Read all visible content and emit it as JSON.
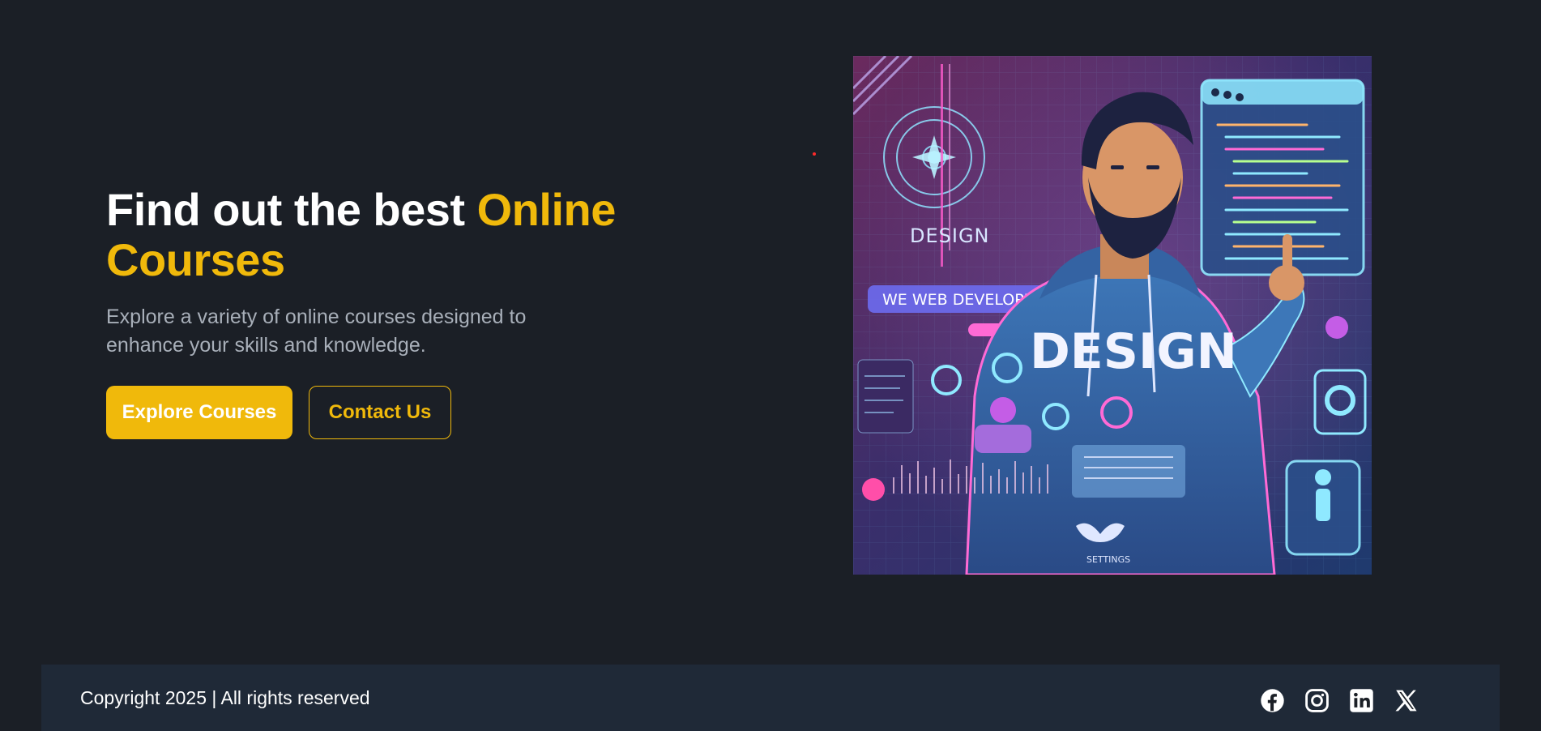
{
  "hero": {
    "headline_prefix": "Find out the best ",
    "headline_accent": "Online Courses",
    "subtitle": "Explore a variety of online courses designed to enhance your skills and knowledge.",
    "primary_button": "Explore Courses",
    "secondary_button": "Contact Us",
    "image": {
      "alt": "Web developer illustration",
      "labels": {
        "design_small": "DESIGN",
        "banner": "WE WEB DEVELOPER",
        "shirt": "DESIGN",
        "settings": "SETTINGS"
      }
    }
  },
  "footer": {
    "copyright": "Copyright 2025 | All rights reserved",
    "social": [
      "facebook-icon",
      "instagram-icon",
      "linkedin-icon",
      "x-icon"
    ]
  },
  "colors": {
    "background": "#1b1f26",
    "footer_bg": "#1f2937",
    "accent": "#f0b90b",
    "text": "#ffffff",
    "muted": "#a8afb9"
  }
}
